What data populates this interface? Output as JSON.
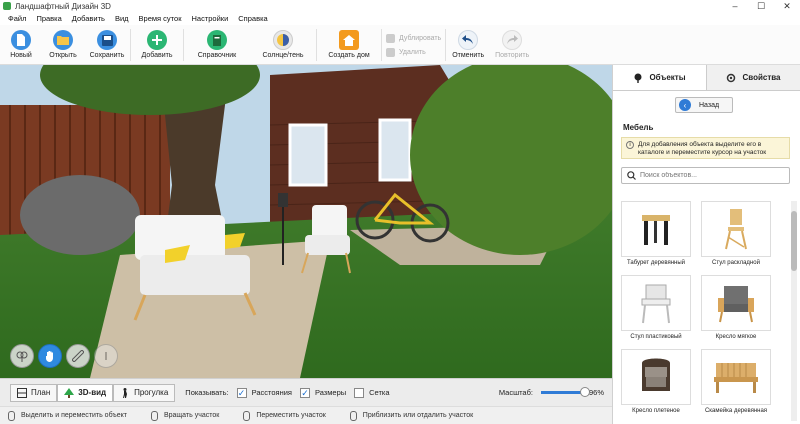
{
  "window": {
    "title": "Ландшафтный Дизайн 3D"
  },
  "menu": [
    "Файл",
    "Правка",
    "Добавить",
    "Вид",
    "Время суток",
    "Настройки",
    "Справка"
  ],
  "toolbar": {
    "new": "Новый",
    "open": "Открыть",
    "save": "Сохранить",
    "add": "Добавить",
    "reference": "Справочник",
    "sunshade": "Солнце/тень",
    "create_house": "Создать дом",
    "duplicate": "Дублировать",
    "delete": "Удалить",
    "undo": "Отменить",
    "redo": "Повторить"
  },
  "panel": {
    "tab_objects": "Объекты",
    "tab_properties": "Свойства",
    "back": "Назад",
    "section": "Мебель",
    "hint": "Для добавления объекта выделите его в каталоге и переместите курсор на участок",
    "search_placeholder": "Поиск объектов...",
    "items": [
      {
        "label": "Табурет деревянный"
      },
      {
        "label": "Стул раскладной"
      },
      {
        "label": "Стул пластиковый"
      },
      {
        "label": "Кресло мягкое"
      },
      {
        "label": "Кресло плетеное"
      },
      {
        "label": "Скамейка деревянная"
      }
    ]
  },
  "viewbar": {
    "plan": "План",
    "view3d": "3D-вид",
    "walk": "Прогулка",
    "show": "Показывать:",
    "distances": "Расстояния",
    "sizes": "Размеры",
    "grid": "Сетка",
    "scale_label": "Масштаб:",
    "scale_value": "96%",
    "scale_fraction": 0.96
  },
  "status": {
    "select_move": "Выделить и переместить объект",
    "rotate": "Вращать участок",
    "move": "Переместить участок",
    "zoom": "Приблизить или отдалить участок"
  },
  "colors": {
    "accent": "#2f7bd6",
    "add_green": "#2bb673",
    "house_orange": "#f39a1e"
  }
}
